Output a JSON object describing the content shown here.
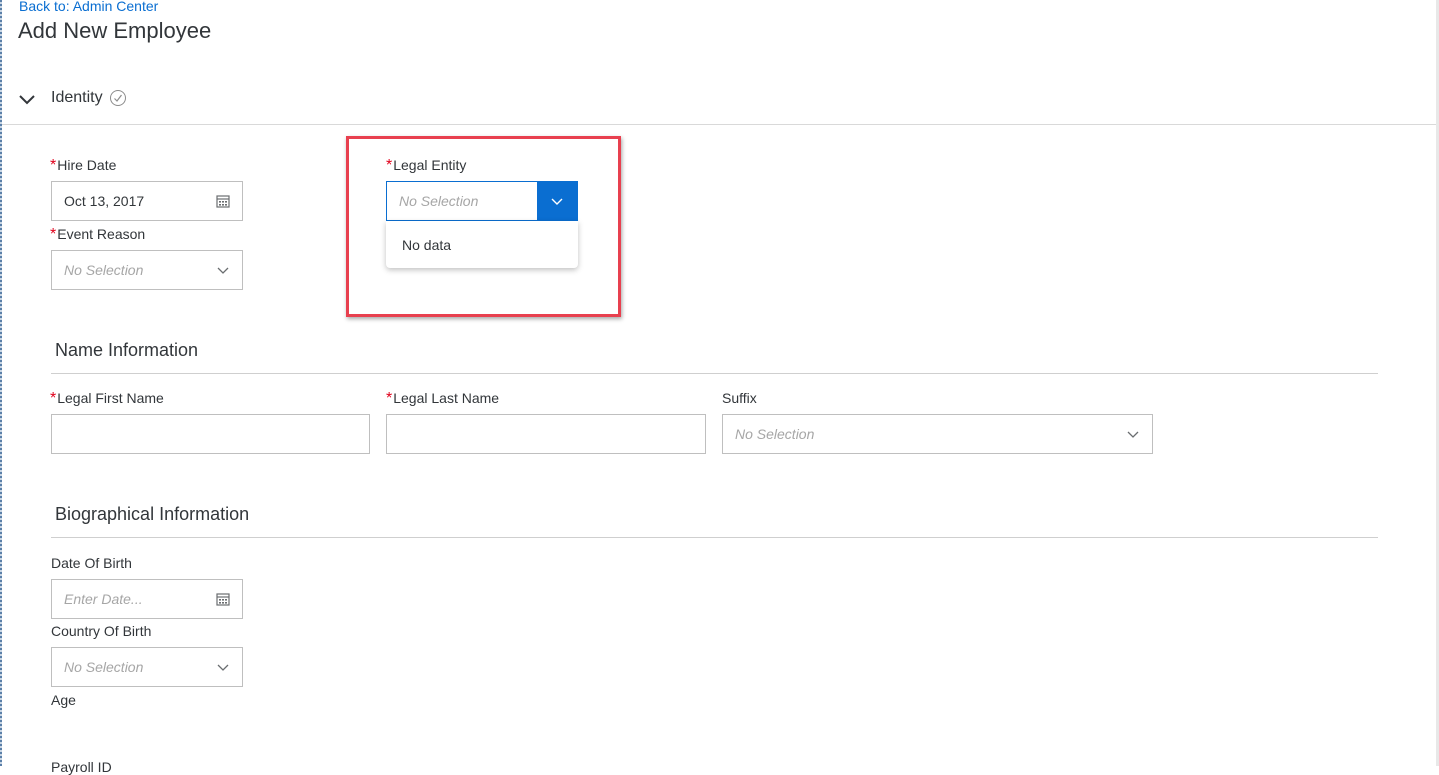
{
  "header": {
    "back_link": "Back to: Admin Center",
    "title": "Add New Employee"
  },
  "identity": {
    "label": "Identity",
    "hire_date": {
      "label": "Hire Date",
      "value": "Oct 13, 2017",
      "required": true
    },
    "event_reason": {
      "label": "Event Reason",
      "placeholder": "No Selection",
      "required": true
    },
    "legal_entity": {
      "label": "Legal Entity",
      "placeholder": "No Selection",
      "required": true,
      "dropdown_open": true,
      "dropdown_message": "No data"
    }
  },
  "name_information": {
    "title": "Name Information",
    "legal_first_name": {
      "label": "Legal First Name",
      "value": "",
      "required": true
    },
    "legal_last_name": {
      "label": "Legal Last Name",
      "value": "",
      "required": true
    },
    "suffix": {
      "label": "Suffix",
      "placeholder": "No Selection"
    }
  },
  "biographical_information": {
    "title": "Biographical Information",
    "date_of_birth": {
      "label": "Date Of Birth",
      "placeholder": "Enter Date..."
    },
    "country_of_birth": {
      "label": "Country Of Birth",
      "placeholder": "No Selection"
    },
    "age": {
      "label": "Age"
    },
    "payroll_id": {
      "label": "Payroll ID"
    }
  },
  "icons": {
    "calendar": "calendar-icon",
    "chevron_down": "chevron-down-icon",
    "check_circle": "check-circle-icon"
  },
  "colors": {
    "accent": "#0a6ed1",
    "required": "#e0001b",
    "highlight": "#e8404f"
  }
}
